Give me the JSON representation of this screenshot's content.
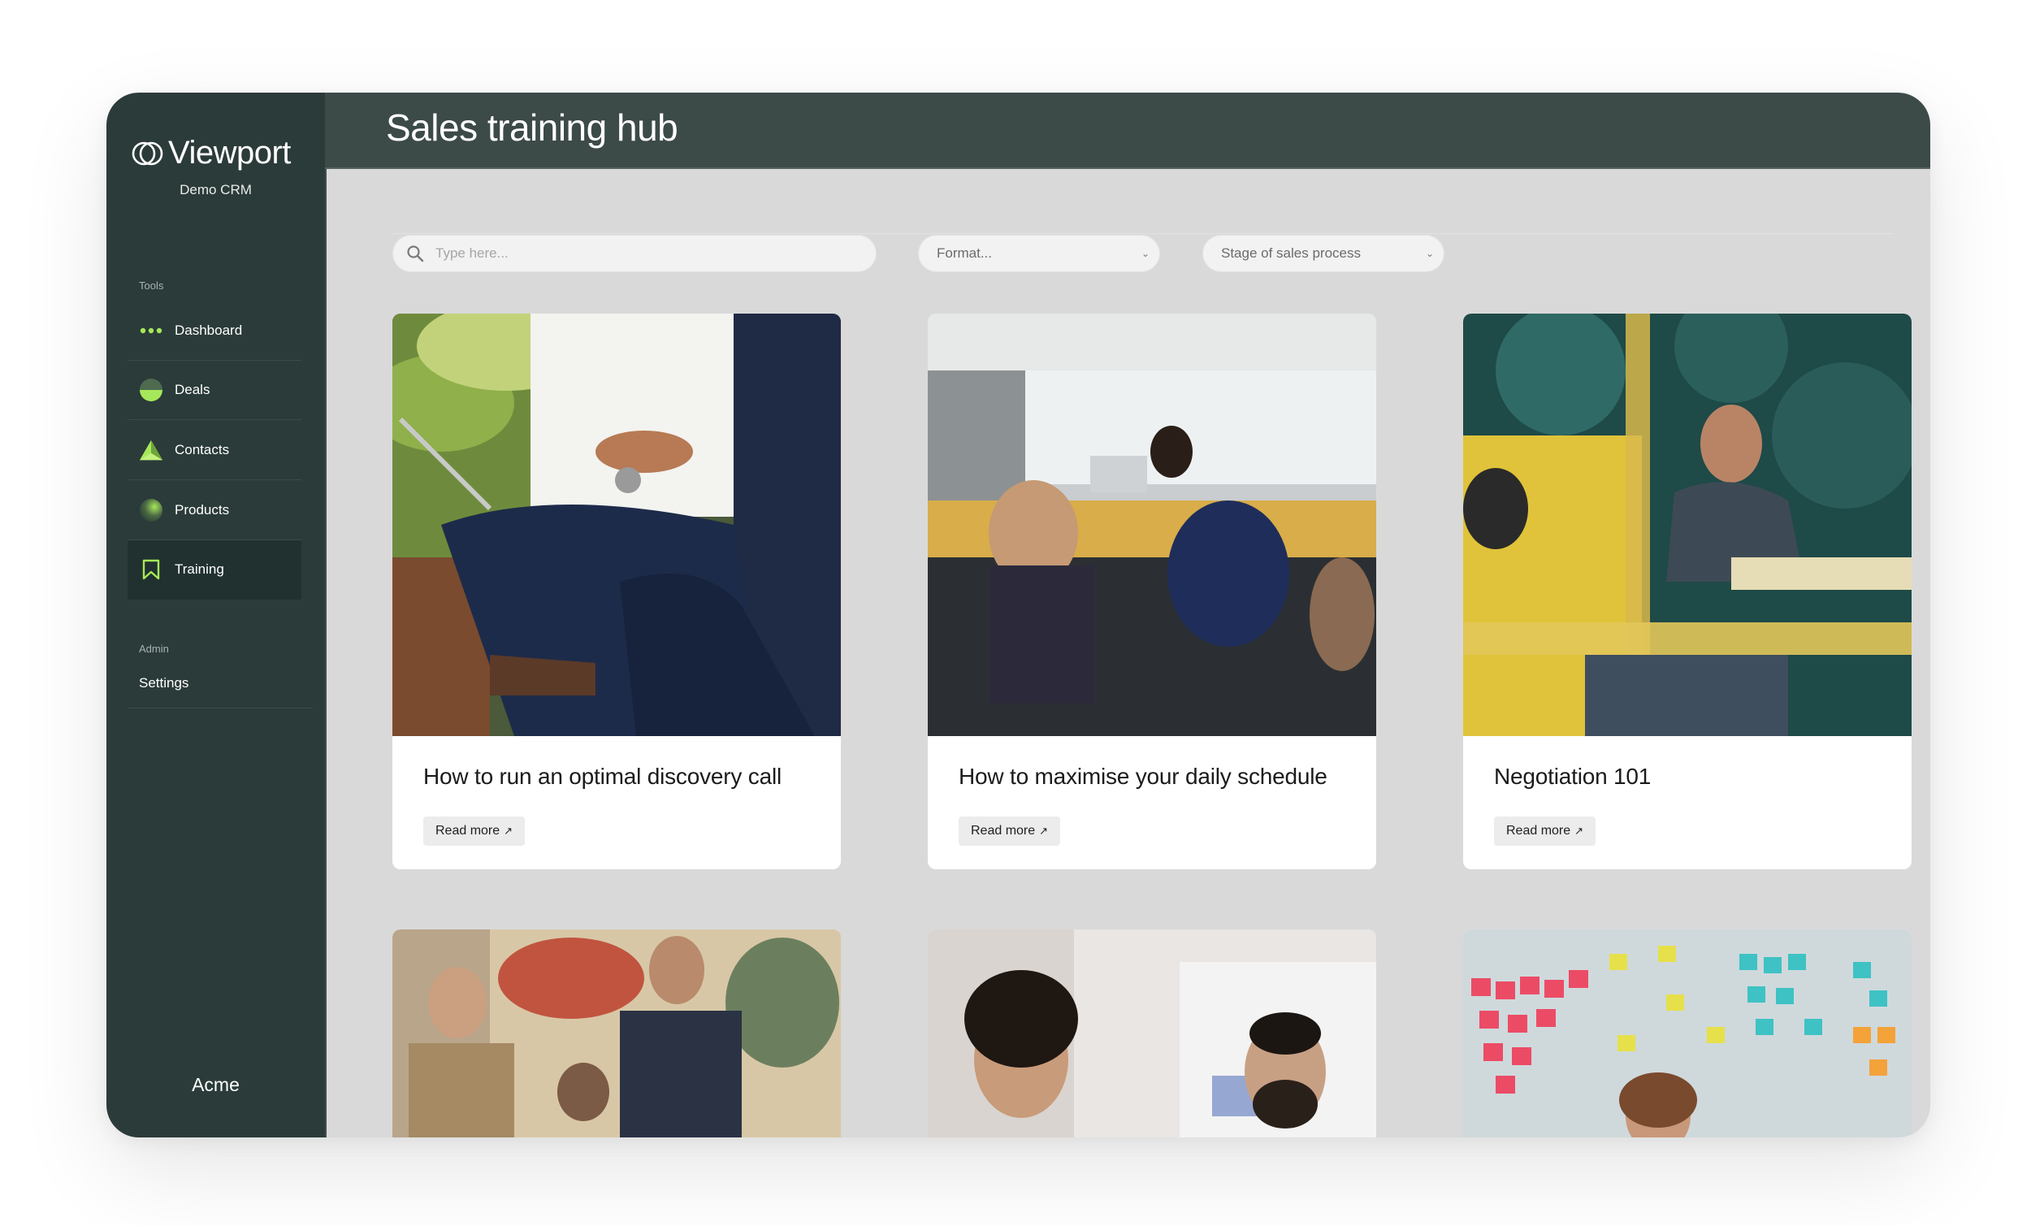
{
  "brand": {
    "name": "Viewport",
    "subtitle": "Demo CRM",
    "footer": "Acme"
  },
  "sidebar": {
    "tools_label": "Tools",
    "items": [
      {
        "label": "Dashboard",
        "icon": "dots-icon"
      },
      {
        "label": "Deals",
        "icon": "half-circle-icon"
      },
      {
        "label": "Contacts",
        "icon": "triangle-icon"
      },
      {
        "label": "Products",
        "icon": "sphere-icon"
      },
      {
        "label": "Training",
        "icon": "bookmark-icon",
        "active": true
      }
    ],
    "admin_label": "Admin",
    "admin_items": [
      {
        "label": "Settings"
      }
    ]
  },
  "header": {
    "title": "Sales training hub"
  },
  "filters": {
    "search_placeholder": "Type here...",
    "format_select": "Format...",
    "stage_select": "Stage of sales process"
  },
  "cards": [
    {
      "title": "How to run an optimal discovery call",
      "cta": "Read more"
    },
    {
      "title": "How to maximise your daily schedule",
      "cta": "Read more"
    },
    {
      "title": "Negotiation 101",
      "cta": "Read more"
    }
  ],
  "colors": {
    "sidebar_bg": "#2b3b39",
    "header_bg": "#3c4a48",
    "accent": "#a6e85a",
    "content_bg": "#d9d9d9"
  }
}
